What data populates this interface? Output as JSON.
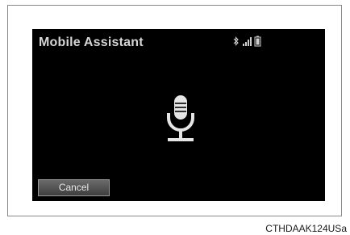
{
  "screen": {
    "title": "Mobile Assistant",
    "cancel_label": "Cancel"
  },
  "status_icons": [
    "bluetooth-icon",
    "signal-strength-icon",
    "battery-icon"
  ],
  "figure_code": "CTHDAAK124USa"
}
